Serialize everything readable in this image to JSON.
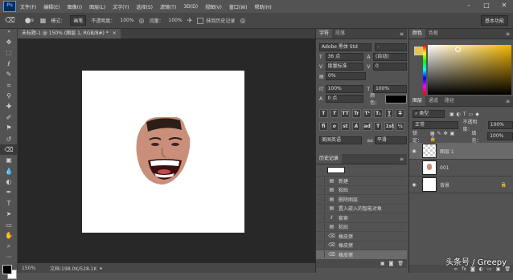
{
  "app": {
    "logo": "Ps"
  },
  "menu": [
    "文件(F)",
    "编辑(E)",
    "图像(I)",
    "图层(L)",
    "文字(Y)",
    "选择(S)",
    "滤镜(T)",
    "3D(D)",
    "视图(V)",
    "窗口(W)",
    "帮助(H)"
  ],
  "options": {
    "brush_size": "9",
    "mode_label": "模式：",
    "mode_value": "画笔",
    "opacity_label": "不透明度：",
    "opacity_value": "100%",
    "flow_label": "流量：",
    "flow_value": "100%",
    "history_label": "抹到历史记录",
    "workspace": "基本功能"
  },
  "document": {
    "tab_title": "未标题-1 @ 150% (图层 1, RGB/8#) *",
    "zoom": "150%",
    "doc_info": "文档:198.0K/528.1K"
  },
  "character": {
    "tabs": [
      "字符",
      "段落"
    ],
    "font_family": "Adobe 黑体 Std",
    "font_style": "-",
    "size": "36 点",
    "leading": "(自动)",
    "kerning": "度量标准",
    "tracking": "0",
    "scale_pct": "0%",
    "v_scale": "100%",
    "h_scale": "100%",
    "baseline": "0 点",
    "color_label": "颜色：",
    "language": "美国英语",
    "antialias": "平滑",
    "style_buttons": [
      "T",
      "T",
      "TT",
      "Tr",
      "T¹",
      "T₁",
      "T",
      "T"
    ]
  },
  "history": {
    "title": "历史记录",
    "items": [
      "新建",
      "粘贴",
      "删除图层",
      "置入嵌入的智能对象",
      "套索",
      "粘贴",
      "橡皮擦",
      "橡皮擦",
      "橡皮擦"
    ]
  },
  "color_panel": {
    "tabs": [
      "颜色",
      "色板"
    ],
    "foreground": "#e8c24a"
  },
  "layers": {
    "tabs": [
      "图层",
      "通道",
      "路径"
    ],
    "filter_label": "类型",
    "blend_mode": "正常",
    "opacity_label": "不透明度：",
    "opacity": "100%",
    "lock_label": "锁定：",
    "fill_label": "填充：",
    "fill": "100%",
    "items": [
      {
        "name": "图层 1",
        "selected": true
      },
      {
        "name": "001",
        "selected": false
      },
      {
        "name": "背景",
        "selected": false
      }
    ]
  },
  "watermark": "头条号 / Greepy"
}
